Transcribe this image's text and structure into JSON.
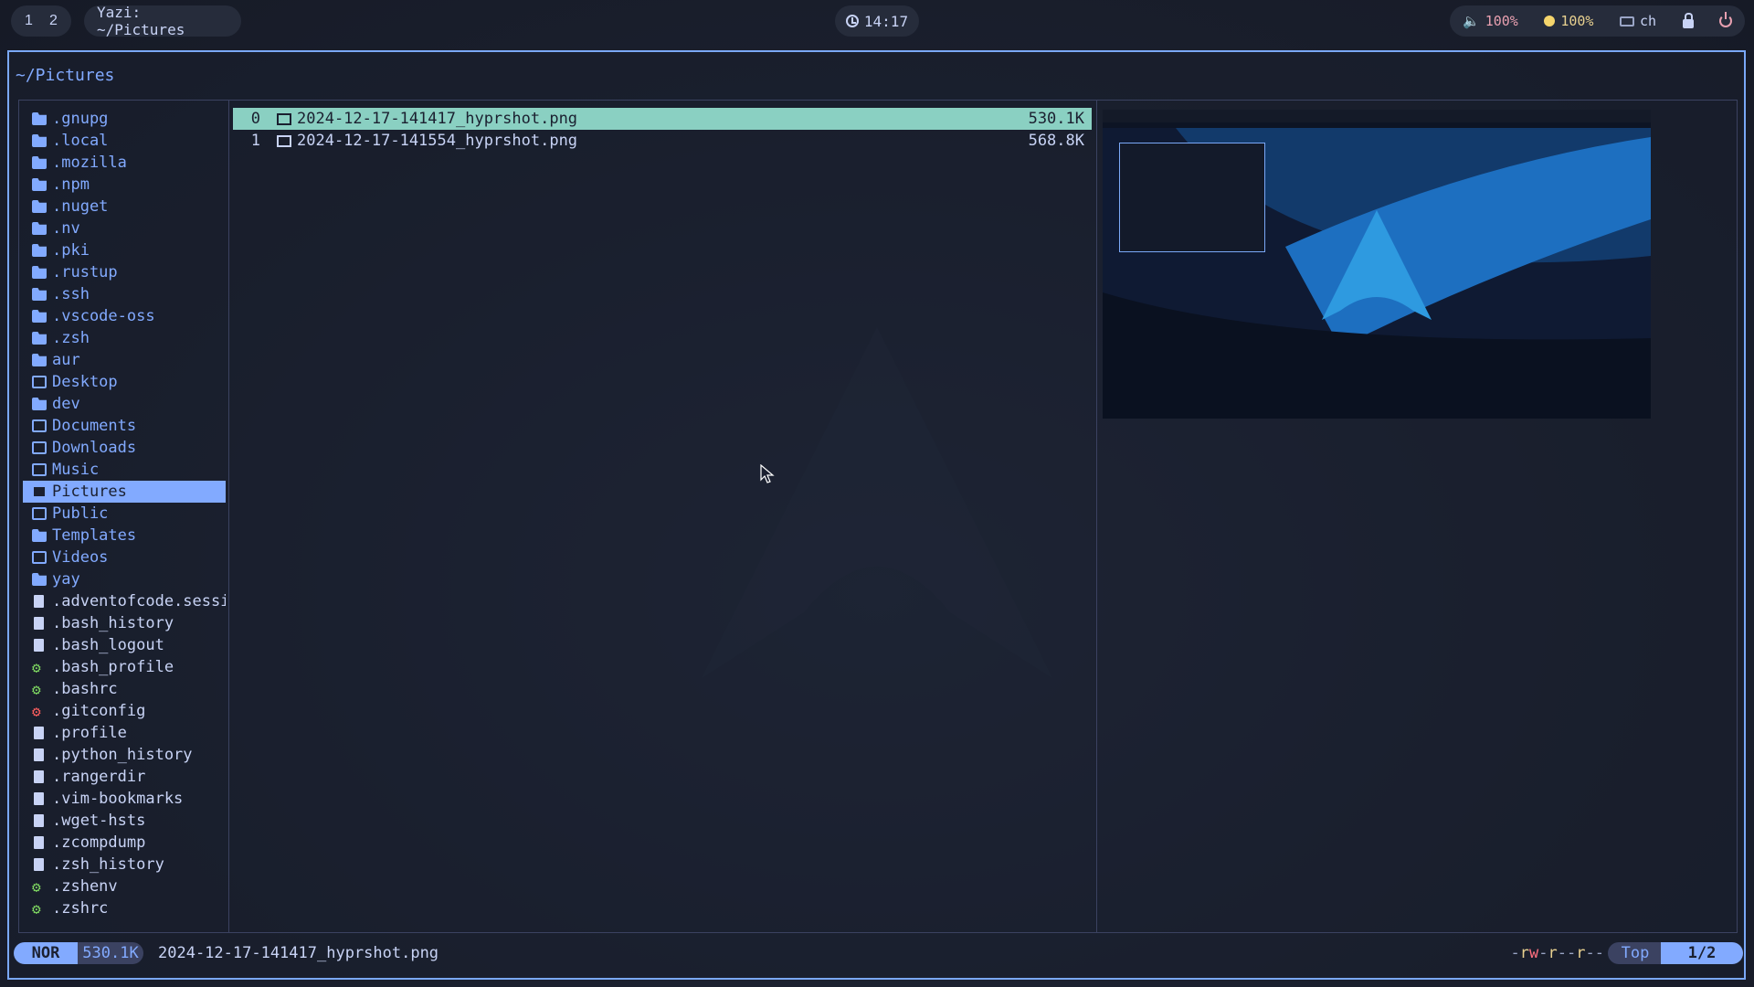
{
  "topbar": {
    "workspaces": [
      "1",
      "2"
    ],
    "window_title": "Yazi: ~/Pictures",
    "clock": "14:17",
    "volume": "100%",
    "brightness": "100%",
    "keyboard_layout": "ch",
    "icons": [
      "clock-icon",
      "volume-icon",
      "brightness-icon",
      "keyboard-icon",
      "lock-icon",
      "power-icon"
    ]
  },
  "header": {
    "path": "~/Pictures"
  },
  "parent": {
    "items": [
      {
        "label": ".gnupg",
        "type": "dir"
      },
      {
        "label": ".local",
        "type": "dir"
      },
      {
        "label": ".mozilla",
        "type": "dir"
      },
      {
        "label": ".npm",
        "type": "dir"
      },
      {
        "label": ".nuget",
        "type": "dir"
      },
      {
        "label": ".nv",
        "type": "dir"
      },
      {
        "label": ".pki",
        "type": "dir"
      },
      {
        "label": ".rustup",
        "type": "dir"
      },
      {
        "label": ".ssh",
        "type": "dir"
      },
      {
        "label": ".vscode-oss",
        "type": "dir"
      },
      {
        "label": ".zsh",
        "type": "dir"
      },
      {
        "label": "aur",
        "type": "dir"
      },
      {
        "label": "Desktop",
        "type": "special"
      },
      {
        "label": "dev",
        "type": "dir"
      },
      {
        "label": "Documents",
        "type": "special"
      },
      {
        "label": "Downloads",
        "type": "special"
      },
      {
        "label": "Music",
        "type": "special"
      },
      {
        "label": "Pictures",
        "type": "special",
        "selected": true
      },
      {
        "label": "Public",
        "type": "special"
      },
      {
        "label": "Templates",
        "type": "dir"
      },
      {
        "label": "Videos",
        "type": "special"
      },
      {
        "label": "yay",
        "type": "dir"
      },
      {
        "label": ".adventofcode.sessi",
        "type": "file"
      },
      {
        "label": ".bash_history",
        "type": "file"
      },
      {
        "label": ".bash_logout",
        "type": "file"
      },
      {
        "label": ".bash_profile",
        "type": "config"
      },
      {
        "label": ".bashrc",
        "type": "config"
      },
      {
        "label": ".gitconfig",
        "type": "git"
      },
      {
        "label": ".profile",
        "type": "file"
      },
      {
        "label": ".python_history",
        "type": "file"
      },
      {
        "label": ".rangerdir",
        "type": "file"
      },
      {
        "label": ".vim-bookmarks",
        "type": "file"
      },
      {
        "label": ".wget-hsts",
        "type": "file"
      },
      {
        "label": ".zcompdump",
        "type": "file"
      },
      {
        "label": ".zsh_history",
        "type": "file"
      },
      {
        "label": ".zshenv",
        "type": "config"
      },
      {
        "label": ".zshrc",
        "type": "config"
      }
    ]
  },
  "current": {
    "files": [
      {
        "index": "0",
        "name": "2024-12-17-141417_hyprshot.png",
        "size": "530.1K",
        "selected": true
      },
      {
        "index": "1",
        "name": "2024-12-17-141554_hyprshot.png",
        "size": "568.8K",
        "selected": false
      }
    ]
  },
  "status": {
    "mode": "NOR",
    "size": "530.1K",
    "filename": "2024-12-17-141417_hyprshot.png",
    "perm_parts": [
      "-",
      "r",
      "w",
      "-",
      "r",
      "-",
      "-",
      "r",
      "-",
      "-"
    ],
    "position": "Top",
    "count": "1/2"
  },
  "colors": {
    "accent": "#82aaff",
    "selection": "#8ad0c2",
    "border": "#7aa8f7",
    "background": "#1b2030"
  }
}
